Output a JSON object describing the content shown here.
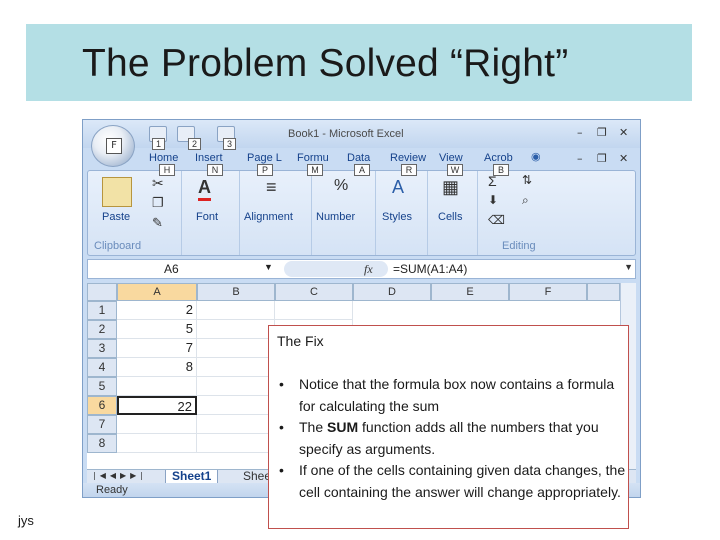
{
  "slide": {
    "title": "The Problem Solved “Right”",
    "footer": "jys"
  },
  "excel": {
    "window_title": "Book1 - Microsoft Excel",
    "quick_access_keys": [
      "1",
      "2",
      "3"
    ],
    "office_key": "F",
    "tabs": [
      {
        "label": "Home",
        "key": "H"
      },
      {
        "label": "Insert",
        "key": "N"
      },
      {
        "label": "Page L",
        "key": "P"
      },
      {
        "label": "Formu",
        "key": "M"
      },
      {
        "label": "Data",
        "key": "A"
      },
      {
        "label": "Review",
        "key": "R"
      },
      {
        "label": "View",
        "key": "W"
      },
      {
        "label": "Acrob",
        "key": "B"
      }
    ],
    "ribbon": {
      "clipboard_label": "Clipboard",
      "paste_label": "Paste",
      "font_label": "Font",
      "alignment_label": "Alignment",
      "number_label": "Number",
      "styles_label": "Styles",
      "cells_label": "Cells",
      "editing_label": "Editing"
    },
    "name_box": "A6",
    "fx": "fx",
    "formula": "=SUM(A1:A4)",
    "columns": [
      "A",
      "B",
      "C",
      "D",
      "E",
      "F"
    ],
    "rows": [
      {
        "num": "1",
        "a": "2"
      },
      {
        "num": "2",
        "a": "5"
      },
      {
        "num": "3",
        "a": "7"
      },
      {
        "num": "4",
        "a": "8"
      },
      {
        "num": "5",
        "a": ""
      },
      {
        "num": "6",
        "a": "22"
      },
      {
        "num": "7",
        "a": ""
      },
      {
        "num": "8",
        "a": ""
      }
    ],
    "active_row_index": 5,
    "sheet_tabs": {
      "active": "Sheet1",
      "other": "Shee"
    },
    "status": "Ready"
  },
  "fix": {
    "heading": "The Fix",
    "bullet_char": "•",
    "bullets": [
      "Notice that the formula box now contains a formula for calculating the sum",
      "The SUM function adds all the numbers that you specify as arguments.",
      "If one of the cells containing given data changes, the cell containing the answer will change appropriately."
    ]
  }
}
